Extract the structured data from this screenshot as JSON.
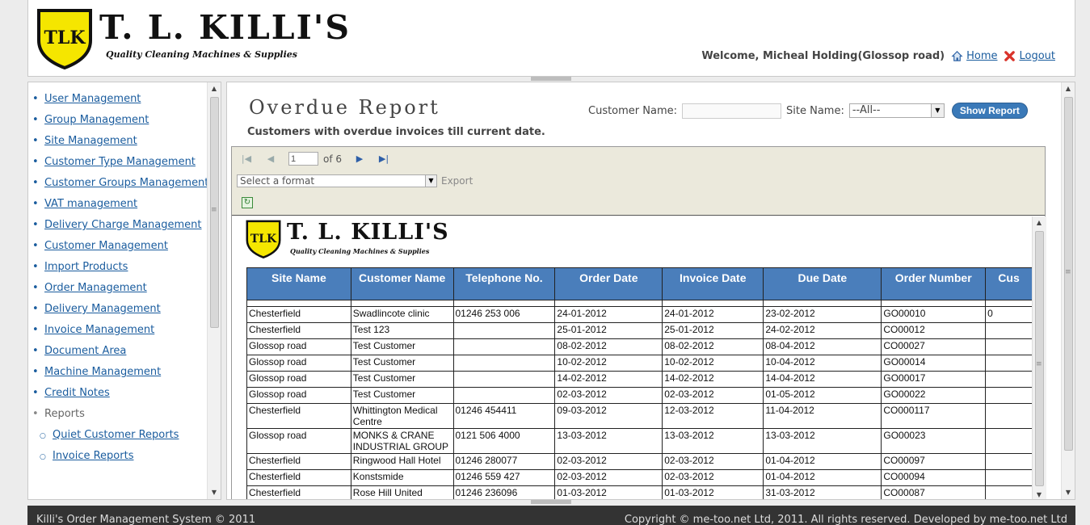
{
  "brand": {
    "name": "T. L. KILLI'S",
    "tagline": "Quality Cleaning Machines & Supplies",
    "monogram": "TLK",
    "shield_color": "#f5e600"
  },
  "header": {
    "welcome": "Welcome, Micheal Holding(Glossop road)",
    "home_label": "Home",
    "logout_label": "Logout"
  },
  "sidebar": {
    "items": [
      {
        "label": "User Management"
      },
      {
        "label": "Group Management"
      },
      {
        "label": "Site Management"
      },
      {
        "label": "Customer Type Management"
      },
      {
        "label": "Customer Groups Management"
      },
      {
        "label": "VAT management"
      },
      {
        "label": "Delivery Charge Management"
      },
      {
        "label": "Customer Management"
      },
      {
        "label": "Import Products"
      },
      {
        "label": "Order Management"
      },
      {
        "label": "Delivery Management"
      },
      {
        "label": "Invoice Management"
      },
      {
        "label": "Document Area"
      },
      {
        "label": "Machine Management"
      },
      {
        "label": "Credit Notes"
      }
    ],
    "reports_label": "Reports",
    "report_items": [
      {
        "label": "Quiet Customer Reports"
      },
      {
        "label": "Invoice Reports"
      }
    ]
  },
  "main": {
    "title": "Overdue Report",
    "subtitle": "Customers with overdue invoices till current date.",
    "customer_name_label": "Customer Name:",
    "customer_name_value": "",
    "site_name_label": "Site Name:",
    "site_name_value": "--All--",
    "show_report_label": "Show Report"
  },
  "viewer": {
    "current_page": "1",
    "page_of": "of 6",
    "format_placeholder": "Select a format",
    "export_label": "Export"
  },
  "report": {
    "columns": [
      "Site Name",
      "Customer Name",
      "Telephone No.",
      "Order Date",
      "Invoice Date",
      "Due Date",
      "Order Number",
      "Cus"
    ],
    "rows": [
      [
        "Chesterfield",
        "Swadlincote clinic",
        "01246 253 006",
        "24-01-2012",
        "24-01-2012",
        "23-02-2012",
        "GO00010",
        "0"
      ],
      [
        "Chesterfield",
        "Test 123",
        "",
        "25-01-2012",
        "25-01-2012",
        "24-02-2012",
        "CO00012",
        ""
      ],
      [
        "Glossop road",
        "Test Customer",
        "",
        "08-02-2012",
        "08-02-2012",
        "08-04-2012",
        "CO00027",
        ""
      ],
      [
        "Glossop road",
        "Test Customer",
        "",
        "10-02-2012",
        "10-02-2012",
        "10-04-2012",
        "GO00014",
        ""
      ],
      [
        "Glossop road",
        "Test Customer",
        "",
        "14-02-2012",
        "14-02-2012",
        "14-04-2012",
        "GO00017",
        ""
      ],
      [
        "Glossop road",
        "Test Customer",
        "",
        "02-03-2012",
        "02-03-2012",
        "01-05-2012",
        "GO00022",
        ""
      ],
      [
        "Chesterfield",
        "Whittington Medical Centre",
        "01246 454411",
        "09-03-2012",
        "12-03-2012",
        "11-04-2012",
        "CO000117",
        ""
      ],
      [
        "Glossop road",
        "MONKS & CRANE INDUSTRIAL GROUP",
        "0121 506 4000",
        "13-03-2012",
        "13-03-2012",
        "13-03-2012",
        "GO00023",
        ""
      ],
      [
        "Chesterfield",
        "Ringwood Hall Hotel",
        "01246 280077",
        "02-03-2012",
        "02-03-2012",
        "01-04-2012",
        "CO00097",
        ""
      ],
      [
        "Chesterfield",
        "Konstsmide",
        "01246 559 427",
        "02-03-2012",
        "02-03-2012",
        "01-04-2012",
        "CO00094",
        ""
      ],
      [
        "Chesterfield",
        "Rose Hill United",
        "01246 236096",
        "01-03-2012",
        "01-03-2012",
        "31-03-2012",
        "CO00087",
        ""
      ]
    ]
  },
  "footer": {
    "left": "Killi's Order Management System © 2011",
    "right": "Copyright © me-too.net Ltd, 2011. All rights reserved. Developed by me-too.net Ltd"
  }
}
